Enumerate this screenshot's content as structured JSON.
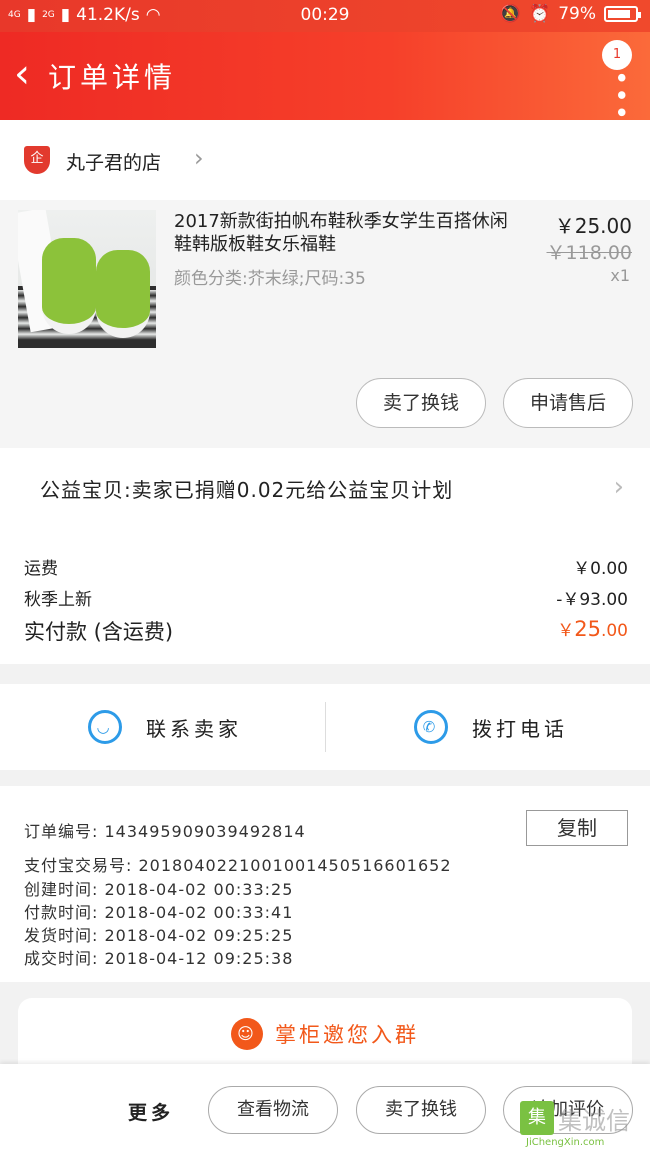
{
  "status_bar": {
    "network": "4G",
    "network2": "2G",
    "speed": "41.2K/s",
    "time": "00:29",
    "battery": "79%"
  },
  "nav": {
    "title": "订单详情",
    "back_icon": "chevron-left-icon",
    "badge": "1"
  },
  "shop": {
    "name": "丸子君的店",
    "logo_text": "企"
  },
  "product": {
    "title": "2017新款街拍帆布鞋秋季女学生百搭休闲鞋韩版板鞋女乐福鞋",
    "spec": "颜色分类:芥末绿;尺码:35",
    "price": "￥25.00",
    "original_price": "￥118.00",
    "quantity": "x1",
    "buttons": [
      "卖了换钱",
      "申请售后"
    ]
  },
  "charity": {
    "text": "公益宝贝:卖家已捐赠0.02元给公益宝贝计划"
  },
  "fees": [
    {
      "label": "运费",
      "value": "￥0.00"
    },
    {
      "label": "秋季上新",
      "value": "-￥93.00"
    }
  ],
  "total": {
    "label": "实付款 (含运费)",
    "currency": "￥",
    "amount": "25",
    "decimals": ".00"
  },
  "contact": {
    "seller_label": "联系卖家",
    "phone_label": "拨打电话"
  },
  "order_info": {
    "order_no": "订单编号:  143495909039492814",
    "copy_label": "复制",
    "alipay_no": "支付宝交易号:  2018040221001001450516601652",
    "created": "创建时间:  2018-04-02 00:33:25",
    "paid": "付款时间:  2018-04-02 00:33:41",
    "shipped": "发货时间:  2018-04-02 09:25:25",
    "completed": "成交时间:  2018-04-12 09:25:38"
  },
  "group": {
    "label": "掌柜邀您入群"
  },
  "bottom_bar": {
    "more": "更多",
    "buttons": [
      "查看物流",
      "卖了换钱",
      "追加评价"
    ]
  },
  "watermark": {
    "text": "集诚信",
    "url": "JiChengXin.com"
  },
  "colors": {
    "header_red": "#ee2a24",
    "accent_orange": "#f2581a",
    "icon_blue": "#2d9be8"
  }
}
